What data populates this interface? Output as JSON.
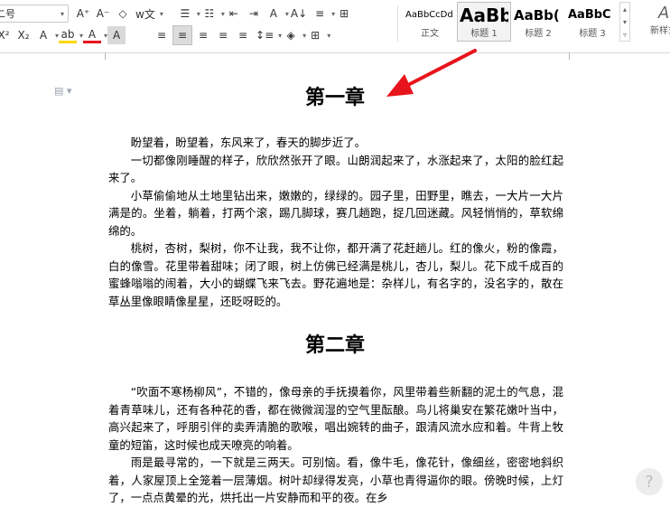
{
  "ribbon": {
    "font_size_value": "二号",
    "row1": {
      "grow_font": "A⁺",
      "shrink_font": "A⁻",
      "clear_format": "◇",
      "phonetic": "w文",
      "bullets": "☰",
      "numbering": "☷",
      "decrease_indent": "⇤",
      "increase_indent": "⇥",
      "char_scale": "A",
      "sort": "A↓",
      "line_numbers": "≡",
      "borders": "⊞"
    },
    "row2": {
      "superscript": "X²",
      "subscript": "X₂",
      "text_effect": "A",
      "highlight": "ab",
      "font_color": "A",
      "char_shading": "A",
      "align_left": "≡",
      "align_center": "≡",
      "align_right": "≡",
      "justify": "≡",
      "distributed": "≡",
      "line_spacing": "↕≡",
      "shading": "◈",
      "border_box": "⊞"
    },
    "styles": [
      {
        "preview": "AaBbCcDd",
        "name": "正文"
      },
      {
        "preview": "AaBb",
        "name": "标题 1"
      },
      {
        "preview": "AaBb(",
        "name": "标题 2"
      },
      {
        "preview": "AaBbC",
        "name": "标题 3"
      }
    ],
    "new_style_label": "新样式",
    "new_style_glyph": "A"
  },
  "document": {
    "chapter1_title": "第一章",
    "chapter1_paragraphs": [
      "盼望着，盼望着，东风来了，春天的脚步近了。",
      "一切都像刚睡醒的样子，欣欣然张开了眼。山朗润起来了，水涨起来了，太阳的脸红起来了。",
      "小草偷偷地从土地里钻出来，嫩嫩的，绿绿的。园子里，田野里，瞧去，一大片一大片满是的。坐着，躺着，打两个滚，踢几脚球，赛几趟跑，捉几回迷藏。风轻悄悄的，草软绵绵的。",
      "桃树，杏树，梨树，你不让我，我不让你，都开满了花赶趟儿。红的像火，粉的像霞，白的像雪。花里带着甜味；闭了眼，树上仿佛已经满是桃儿，杏儿，梨儿。花下成千成百的蜜蜂嗡嗡的闹着，大小的蝴蝶飞来飞去。野花遍地是：杂样儿，有名字的，没名字的，散在草丛里像眼睛像星星，还眨呀眨的。"
    ],
    "chapter2_title": "第二章",
    "chapter2_paragraphs": [
      "“吹面不寒杨柳风”，不错的，像母亲的手抚摸着你，风里带着些新翻的泥土的气息，混着青草味儿，还有各种花的香，都在微微润湿的空气里酝酿。鸟儿将巢安在繁花嫩叶当中，高兴起来了，呼朋引伴的卖弄清脆的歌喉，唱出婉转的曲子，跟清风流水应和着。牛背上牧童的短笛，这时候也成天嘹亮的响着。",
      "雨是最寻常的，一下就是三两天。可别恼。看，像牛毛，像花针，像细丝，密密地斜织着，人家屋顶上全笼着一层薄烟。树叶却绿得发亮，小草也青得逼你的眼。傍晚时候，上灯了，一点点黄晕的光，烘托出一片安静而和平的夜。在乡"
    ]
  },
  "colors": {
    "arrow": "#e8141b",
    "ribbon_border": "#d9d9d9"
  },
  "icons": {
    "doc_nav": "document-icon",
    "help": "help-bubble-icon"
  }
}
